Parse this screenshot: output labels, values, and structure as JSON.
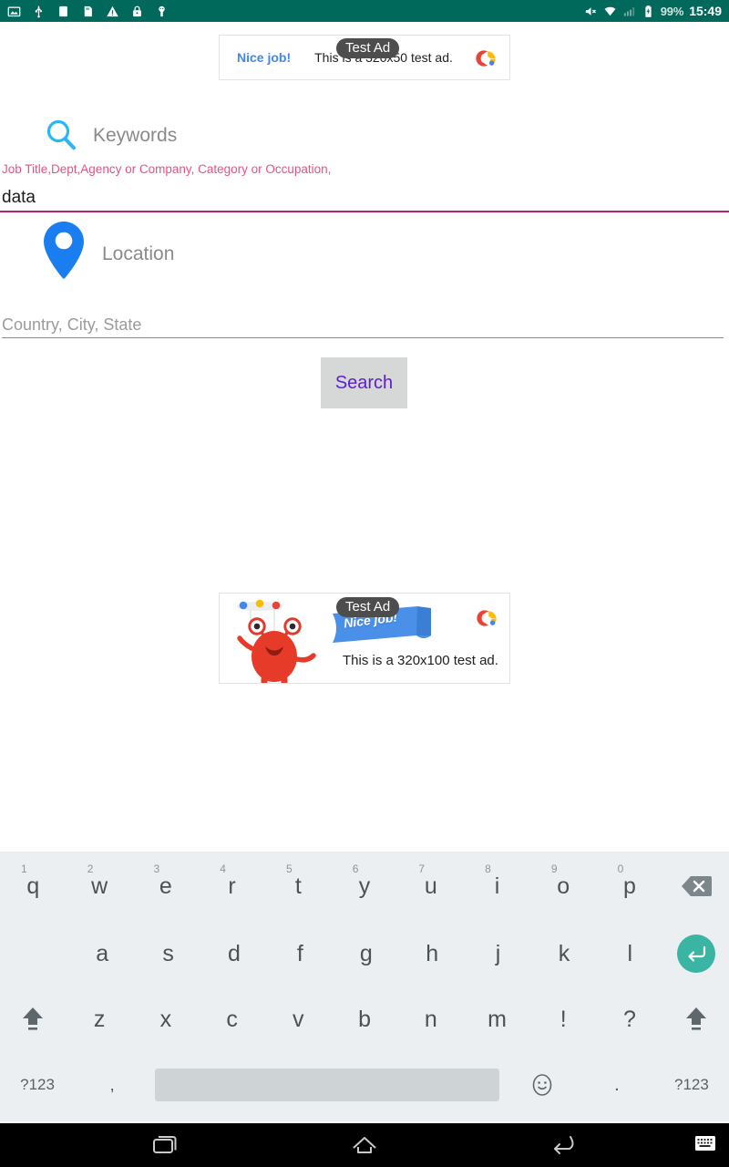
{
  "statusbar": {
    "icons": [
      "image-icon",
      "usb-icon",
      "sd-card-icon",
      "sim-card-icon",
      "warning-icon",
      "lock-icon",
      "usb-debug-icon"
    ],
    "mute_icon": "volume-mute-icon",
    "wifi_icon": "wifi-icon",
    "signal_icon": "cell-signal-icon",
    "battery_icon": "battery-charging-icon",
    "battery_percent": "99%",
    "clock": "15:49"
  },
  "ad_top": {
    "cta": "Nice job!",
    "text": "This is a 320x50 test ad.",
    "badge": "Test Ad",
    "logo": "admob-logo-icon"
  },
  "ad_bottom": {
    "ribbon_text": "Nice job!",
    "text": "This is a 320x100 test ad.",
    "badge": "Test Ad",
    "logo": "admob-logo-icon",
    "character": "red-monster-icon"
  },
  "form": {
    "keywords": {
      "icon": "search-icon",
      "label": "Keywords",
      "hint": "Job Title,Dept,Agency or Company, Category or Occupation,",
      "value": "data",
      "placeholder": "",
      "underline_color": "#b5216e",
      "hint_color": "#e8527f"
    },
    "location": {
      "icon": "location-pin-icon",
      "label": "Location",
      "value": "",
      "placeholder": "Country, City, State"
    },
    "search_button": {
      "label": "Search",
      "text_color": "#5b1fd0",
      "bg_color": "#d6d7d7"
    }
  },
  "keyboard": {
    "row1": [
      {
        "key": "q",
        "sup": "1"
      },
      {
        "key": "w",
        "sup": "2"
      },
      {
        "key": "e",
        "sup": "3"
      },
      {
        "key": "r",
        "sup": "4"
      },
      {
        "key": "t",
        "sup": "5"
      },
      {
        "key": "y",
        "sup": "6"
      },
      {
        "key": "u",
        "sup": "7"
      },
      {
        "key": "i",
        "sup": "8"
      },
      {
        "key": "o",
        "sup": "9"
      },
      {
        "key": "p",
        "sup": "0"
      }
    ],
    "row2": [
      "a",
      "s",
      "d",
      "f",
      "g",
      "h",
      "j",
      "k",
      "l"
    ],
    "row3": [
      "z",
      "x",
      "c",
      "v",
      "b",
      "n",
      "m",
      "!",
      "?"
    ],
    "row4": {
      "sym_left": "?123",
      "comma": ",",
      "space": "",
      "emoji": "emoji-icon",
      "period": ".",
      "sym_right": "?123"
    },
    "backspace": "backspace-icon",
    "enter": "enter-icon",
    "shift_left": "shift-icon",
    "shift_right": "shift-icon",
    "accent_enter": "#3bb5a3"
  },
  "navbar": {
    "recents": "recents-icon",
    "home": "home-icon",
    "back": "back-icon",
    "keyboard_toggle": "keyboard-icon"
  }
}
